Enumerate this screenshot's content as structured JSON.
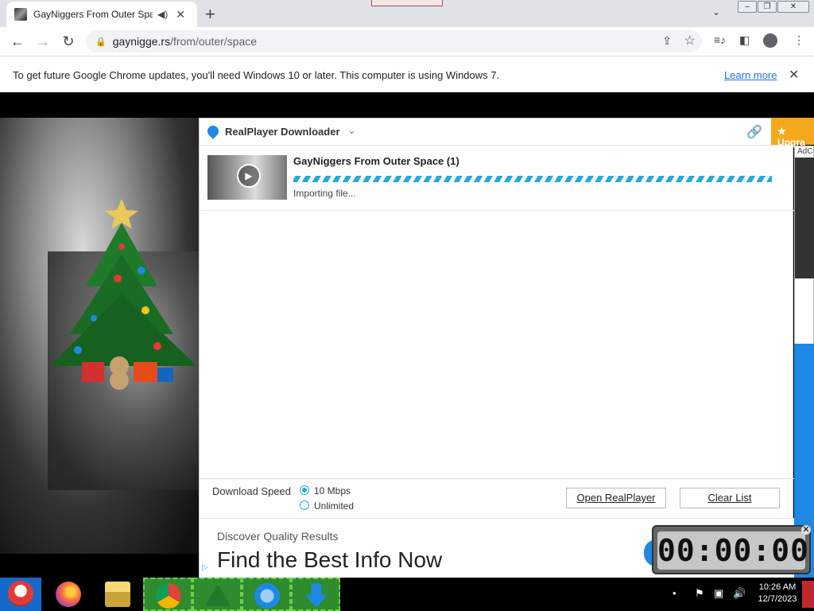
{
  "browser": {
    "tab_title": "GayNiggers From Outer Space",
    "url_host": "gaynigge.rs",
    "url_path": "/from/outer/space"
  },
  "infobar": {
    "message": "To get future Google Chrome updates, you'll need Windows 10 or later. This computer is using Windows 7.",
    "learn_more": "Learn more"
  },
  "realplayer": {
    "title": "RealPlayer Downloader",
    "upgrade": "★ Upgra",
    "item_title": "GayNiggers From Outer Space (1)",
    "item_status": "Importing file...",
    "speed_label": "Download Speed",
    "speed_options": [
      "10 Mbps",
      "Unlimited"
    ],
    "speed_selected": "10 Mbps",
    "open_button": "Open RealPlayer",
    "clear_button": "Clear List"
  },
  "ad": {
    "small": "Discover Quality Results",
    "big": "Find the Best Info Now",
    "side_label": "AdC"
  },
  "timer": {
    "display": "00:00:00"
  },
  "taskbar": {
    "time": "10:26 AM",
    "date": "12/7/2023"
  }
}
